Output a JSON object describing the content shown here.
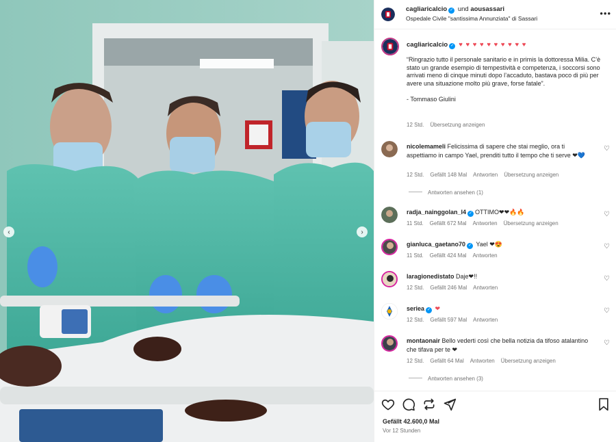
{
  "post": {
    "author": "cagliaricalcio",
    "connector": "und",
    "coauthor": "aousassari",
    "location": "Ospedale Civile \"santissima Annunziata\" di Sassari"
  },
  "caption": {
    "username": "cagliaricalcio",
    "hearts": "♥ ♥ ♥ ♥ ♥ ♥ ♥ ♥ ♥ ♥",
    "paragraph1": "“Ringrazio tutto il personale sanitario e in primis la dottoressa Milia. C’è stato un grande esempio di tempestività e competenza, i soccorsi sono arrivati meno di cinque minuti dopo l’accaduto, bastava poco di più per avere una situazione molto più grave, forse fatale”.",
    "paragraph2": "- Tommaso Giulini",
    "time": "12 Std.",
    "translate": "Übersetzung anzeigen"
  },
  "comments": [
    {
      "username": "nicolemameli",
      "verified": false,
      "text": "Felicissima di sapere che stai meglio, ora ti aspettiamo in campo Yael, prenditi tutto il tempo che ti serve ❤💙",
      "time": "12 Std.",
      "likes": "Gefällt 148 Mal",
      "reply": "Antworten",
      "translate": "Übersetzung anzeigen",
      "view_replies": "Antworten ansehen (1)"
    },
    {
      "username": "radja_nainggolan_l4",
      "verified": true,
      "text": "OTTIMO❤❤🔥🔥",
      "time": "11 Std.",
      "likes": "Gefällt 672 Mal",
      "reply": "Antworten",
      "translate": "Übersetzung anzeigen"
    },
    {
      "username": "gianluca_gaetano70",
      "verified": true,
      "text": "Yael ❤😍",
      "time": "11 Std.",
      "likes": "Gefällt 424 Mal",
      "reply": "Antworten"
    },
    {
      "username": "laragionedistato",
      "verified": false,
      "text": "Daje❤!!",
      "time": "12 Std.",
      "likes": "Gefällt 246 Mal",
      "reply": "Antworten"
    },
    {
      "username": "seriea",
      "verified": true,
      "text": "❤",
      "time": "12 Std.",
      "likes": "Gefällt 597 Mal",
      "reply": "Antworten"
    },
    {
      "username": "montaonair",
      "verified": false,
      "text": "Bello vederti così che bella notizia da tifoso atalantino che tifava per te ❤",
      "time": "12 Std.",
      "likes": "Gefällt 64 Mal",
      "reply": "Antworten",
      "translate": "Übersetzung anzeigen",
      "view_replies": "Antworten ansehen (3)"
    }
  ],
  "footer": {
    "likes": "Gefällt 42.600,0 Mal",
    "ago": "Vor 12 Stunden"
  },
  "icons": {
    "like": "heart-icon",
    "comment": "comment-icon",
    "share": "repost-icon",
    "send": "send-icon",
    "save": "bookmark-icon",
    "more": "more-icon",
    "prev": "chevron-left-icon",
    "next": "chevron-right-icon"
  },
  "colors": {
    "verified": "#0095f6",
    "heart": "#ed4956",
    "muted": "#737373"
  }
}
